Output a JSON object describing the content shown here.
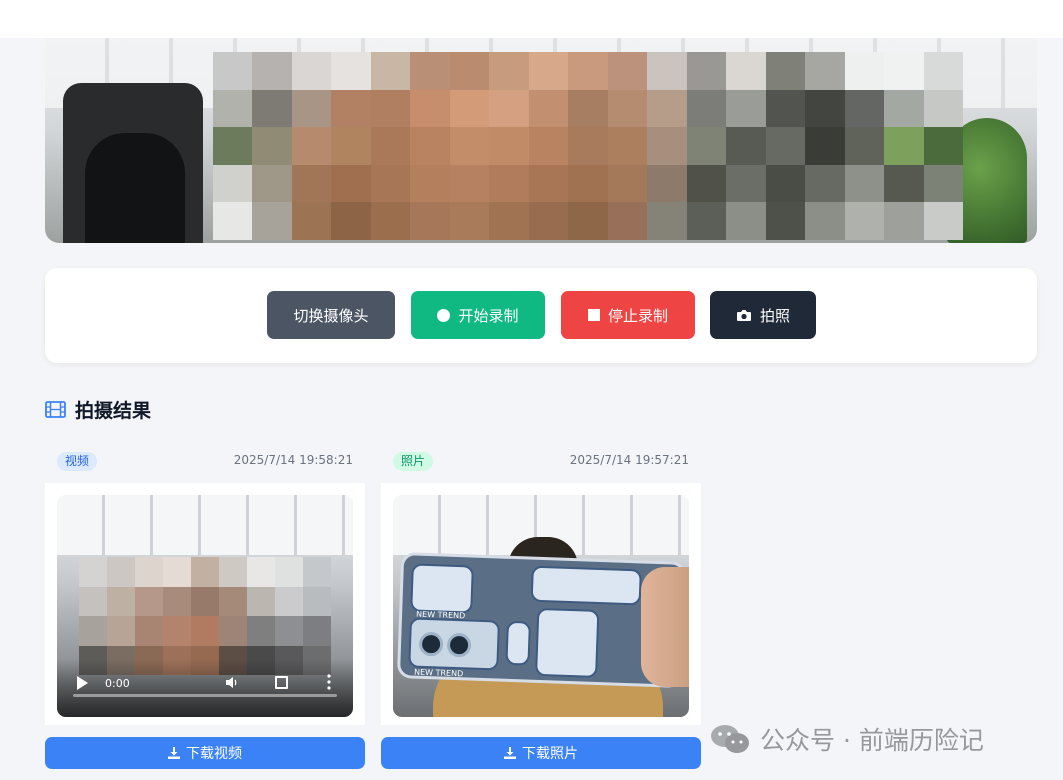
{
  "preview": {
    "mosaic_colors": [
      "#c8c8c8",
      "#b5b2b0",
      "#d9d6d4",
      "#e6e2df",
      "#c9b7a6",
      "#b98f75",
      "#ba8c6f",
      "#c79b7d",
      "#d8a88a",
      "#c99a7e",
      "#bc927c",
      "#cbc4be",
      "#9a9894",
      "#dad6d2",
      "#7f8078",
      "#a6a7a3",
      "#eef0ef",
      "#f0f1f1",
      "#d8dad9",
      "#b0b2ab",
      "#7e7b74",
      "#a89585",
      "#b28063",
      "#b07f61",
      "#c68e6d",
      "#d49b79",
      "#d4a081",
      "#c28f71",
      "#a87e63",
      "#b58c70",
      "#b59d8a",
      "#7c7d78",
      "#9a9c97",
      "#52554f",
      "#434640",
      "#646663",
      "#a4a8a3",
      "#c6c8c6",
      "#6c7b5b",
      "#8f8b74",
      "#b68b6d",
      "#b0845f",
      "#a97959",
      "#b98361",
      "#c48d69",
      "#c28b68",
      "#b98260",
      "#a87b5d",
      "#ac805f",
      "#a68f7c",
      "#7f8376",
      "#575b53",
      "#676a63",
      "#3a3d37",
      "#5f6359",
      "#7ea05d",
      "#4c6b3d",
      "#d0d1cd",
      "#9f9788",
      "#a17656",
      "#9f6f4f",
      "#a67656",
      "#b37f5c",
      "#b68160",
      "#b07c5b",
      "#a87555",
      "#a07252",
      "#a4795a",
      "#8d7a6b",
      "#505249",
      "#6b6e66",
      "#4a4d45",
      "#666a63",
      "#8d918a",
      "#56594f",
      "#7c8376",
      "#e7e8e6",
      "#a7a39a",
      "#9c7454",
      "#8d6446",
      "#9b6e4e",
      "#a67758",
      "#a97b5b",
      "#a07353",
      "#986c4e",
      "#8e6648",
      "#98705a",
      "#858278",
      "#5c5f57",
      "#8c8f88",
      "#4e5149",
      "#8b8f87",
      "#aeb1ac",
      "#9ea19b",
      "#c9cbc8"
    ]
  },
  "controls": {
    "switch_label": "切换摄像头",
    "start_label": "开始录制",
    "stop_label": "停止录制",
    "photo_label": "拍照"
  },
  "results": {
    "title": "拍摄结果",
    "items": [
      {
        "badge": "视频",
        "timestamp": "2025/7/14 19:58:21",
        "download_label": "下载视频",
        "time_display": "0:00",
        "mosaic_colors": [
          "#d5d3d2",
          "#cdc7c3",
          "#ddd4cd",
          "#e4dbd4",
          "#c2b0a3",
          "#cfc9c3",
          "#e8e7e6",
          "#dfe0e0",
          "#c5c8ca",
          "#c4c1be",
          "#bfb0a4",
          "#b6988a",
          "#a98b7b",
          "#977a69",
          "#a58a79",
          "#bcb6b1",
          "#cbcacc",
          "#b9bcbf",
          "#a8a29c",
          "#b7a496",
          "#a88472",
          "#b4836b",
          "#b17b62",
          "#9d8476",
          "#807f80",
          "#8e8f92",
          "#7c7e82",
          "#5d5c59",
          "#7a6d61",
          "#8a6a55",
          "#9d7159",
          "#966a51",
          "#5d4e45",
          "#4a4a4b",
          "#59595b",
          "#6c6d6f"
        ]
      },
      {
        "badge": "照片",
        "timestamp": "2025/7/14 19:57:21",
        "download_label": "下载照片",
        "case_text_1": "NEW TREND",
        "case_text_2": "NEW TREND"
      }
    ]
  },
  "watermark": {
    "text": "公众号 · 前端历险记"
  },
  "colors": {
    "switch": "#4b5563",
    "start": "#10b981",
    "stop": "#ef4444",
    "photo": "#1f2937",
    "download": "#3b82f6",
    "title_icon": "#3b82f6"
  }
}
